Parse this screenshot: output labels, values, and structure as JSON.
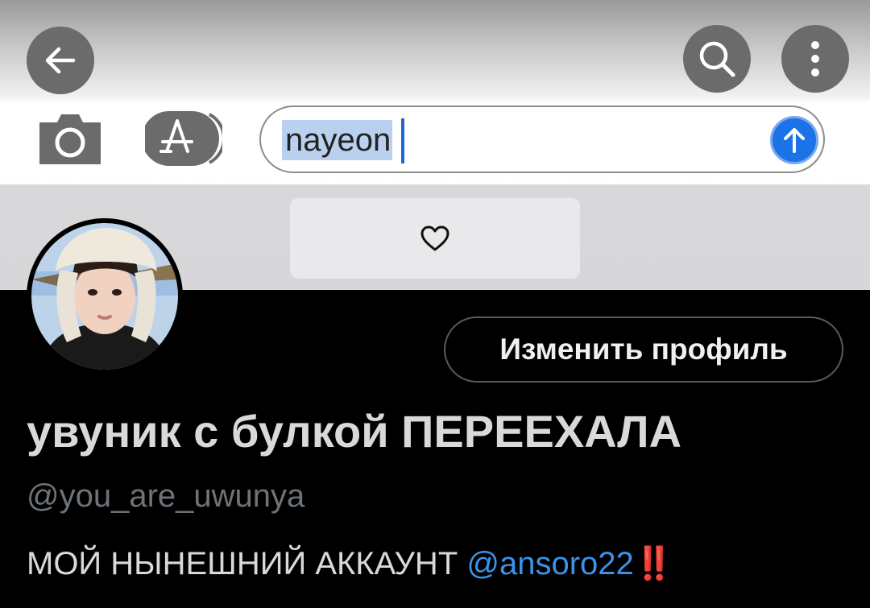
{
  "topbar": {
    "back_icon": "arrow-left-icon",
    "search_icon": "search-icon",
    "more_icon": "more-vertical-icon",
    "button_color": "#6b6b6b"
  },
  "message_bar": {
    "camera_icon": "camera-icon",
    "appstore_icon": "app-store-icon",
    "input_value": "nayeon",
    "send_icon": "arrow-up-icon",
    "send_color": "#1c73e8"
  },
  "reaction": {
    "icon": "heart-icon"
  },
  "profile": {
    "edit_button_label": "Изменить профиль",
    "display_name": "увуник с булкой ПЕРЕЕХАЛА",
    "handle": "@you_are_uwunya",
    "bio_text": "МОЙ НЫНЕШНИЙ АККАУНТ ",
    "bio_mention": "@ansoro22",
    "bio_emoji": "‼️",
    "mention_color": "#3b92e6"
  }
}
